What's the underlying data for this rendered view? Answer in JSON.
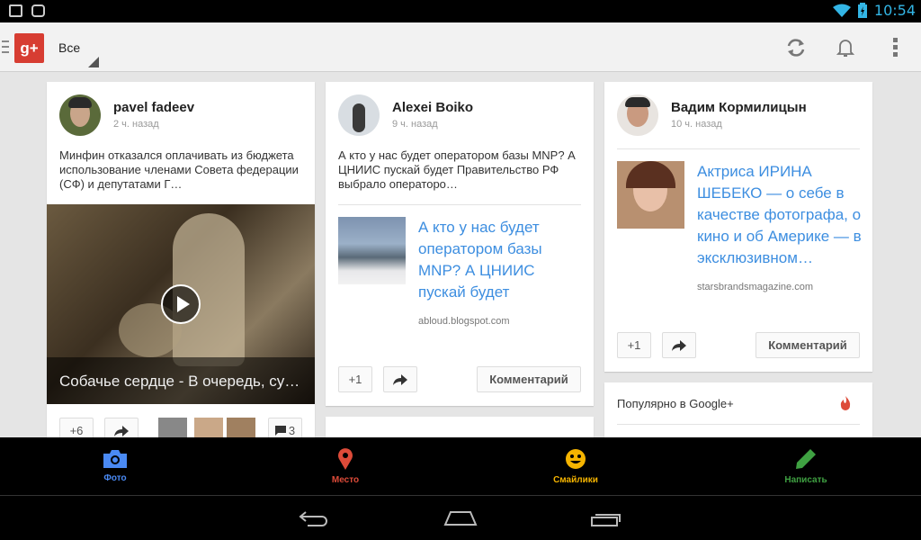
{
  "statusbar": {
    "time": "10:54"
  },
  "topbar": {
    "app_logo": "g+",
    "stream": "Все"
  },
  "posts": [
    {
      "author": "pavel fadeev",
      "time": "2 ч. назад",
      "text": "Минфин отказался оплачивать из бюджета использование членами Совета федерации (СФ) и депутатами Г…",
      "video_caption": "Собачье сердце - В очередь, су…",
      "plus": "+6",
      "comments": "3"
    },
    {
      "author": "Alexei Boiko",
      "time": "9 ч. назад",
      "text": "А кто у нас будет оператором базы MNP? А ЦНИИС пускай будет Правительство РФ выбрало операторо…",
      "link_title": "А кто у нас будет оператором базы MNP? А ЦНИИС пускай будет",
      "link_domain": "abloud.blogspot.com",
      "plus": "+1",
      "comment_label": "Комментарий"
    },
    {
      "author": "Вадим Кормилицын",
      "time": "10 ч. назад",
      "link_title": "Актриса ИРИНА ШЕБЕКО — о себе в качестве фотографа, о кино и об Америке — в эксклюзивном…",
      "link_domain": "starsbrandsmagazine.com",
      "plus": "+1",
      "comment_label": "Комментарий"
    }
  ],
  "trending": {
    "title": "Популярно в Google+"
  },
  "bottom_tabs": [
    {
      "label": "Фото",
      "color": "#4a8af4"
    },
    {
      "label": "Место",
      "color": "#dd4b39"
    },
    {
      "label": "Смайлики",
      "color": "#f5b400"
    },
    {
      "label": "Написать",
      "color": "#3fa142"
    }
  ]
}
